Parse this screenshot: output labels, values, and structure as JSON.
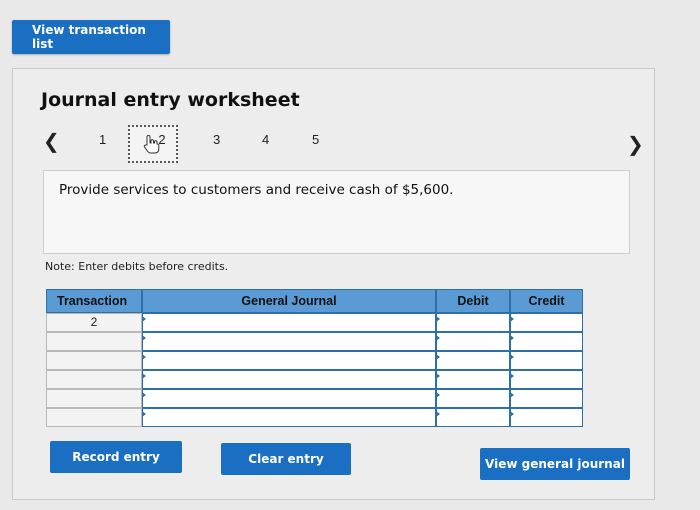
{
  "top_button": {
    "label": "View transaction list"
  },
  "worksheet": {
    "title": "Journal entry worksheet",
    "steps": [
      "1",
      "2",
      "3",
      "4",
      "5"
    ],
    "active_step": "2",
    "description": "Provide services to customers and receive cash of $5,600.",
    "note": "Note: Enter debits before credits."
  },
  "table": {
    "headers": {
      "transaction": "Transaction",
      "general_journal": "General Journal",
      "debit": "Debit",
      "credit": "Credit"
    },
    "rows": [
      {
        "transaction": "2"
      },
      {
        "transaction": ""
      },
      {
        "transaction": ""
      },
      {
        "transaction": ""
      },
      {
        "transaction": ""
      },
      {
        "transaction": ""
      }
    ]
  },
  "buttons": {
    "record": "Record entry",
    "clear": "Clear entry",
    "view_journal": "View general journal"
  },
  "icons": {
    "prev": "chevron-left-icon",
    "next": "chevron-right-icon",
    "cursor": "hand-pointer-icon"
  },
  "colors": {
    "primary": "#1a6fc3",
    "header": "#5b9bd5"
  }
}
